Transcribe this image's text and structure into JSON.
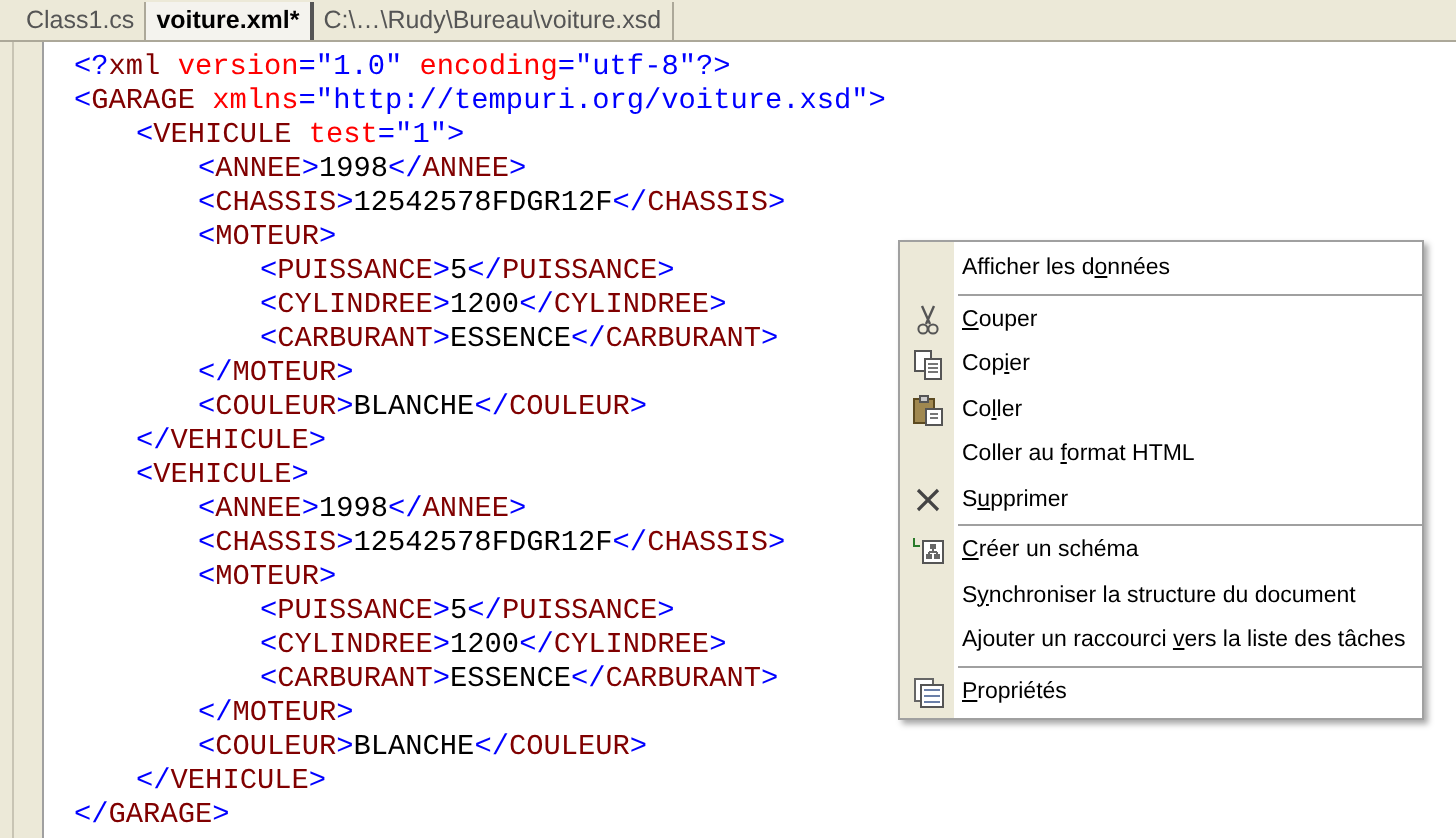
{
  "tabs": [
    {
      "label": "Class1.cs",
      "selected": false
    },
    {
      "label": "voiture.xml*",
      "selected": true
    },
    {
      "label": "C:\\…\\Rudy\\Bureau\\voiture.xsd",
      "selected": false
    }
  ],
  "code": [
    {
      "tokens": [
        {
          "kind": "punct",
          "text": "<?"
        },
        {
          "kind": "tag",
          "text": "xml"
        },
        {
          "kind": "attr",
          "text": " version"
        },
        {
          "kind": "punct",
          "text": "=\""
        },
        {
          "kind": "value",
          "text": "1.0"
        },
        {
          "kind": "punct",
          "text": "\""
        },
        {
          "kind": "attr",
          "text": " encoding"
        },
        {
          "kind": "punct",
          "text": "=\""
        },
        {
          "kind": "value",
          "text": "utf-8"
        },
        {
          "kind": "punct",
          "text": "\"?>"
        }
      ]
    },
    {
      "tokens": [
        {
          "kind": "punct",
          "text": "<"
        },
        {
          "kind": "tag",
          "text": "GARAGE"
        },
        {
          "kind": "attr",
          "text": " xmlns"
        },
        {
          "kind": "punct",
          "text": "=\""
        },
        {
          "kind": "value",
          "text": "http://tempuri.org/voiture.xsd"
        },
        {
          "kind": "punct",
          "text": "\">"
        }
      ],
      "close": [
        {
          "kind": "punct",
          "text": "</"
        },
        {
          "kind": "tag",
          "text": "GARAGE"
        },
        {
          "kind": "punct",
          "text": ">"
        }
      ],
      "children": [
        {
          "tokens": [
            {
              "kind": "punct",
              "text": "<"
            },
            {
              "kind": "tag",
              "text": "VEHICULE"
            },
            {
              "kind": "attr",
              "text": " test"
            },
            {
              "kind": "punct",
              "text": "=\""
            },
            {
              "kind": "value",
              "text": "1"
            },
            {
              "kind": "punct",
              "text": "\">"
            }
          ],
          "close": [
            {
              "kind": "punct",
              "text": "</"
            },
            {
              "kind": "tag",
              "text": "VEHICULE"
            },
            {
              "kind": "punct",
              "text": ">"
            }
          ],
          "children": [
            {
              "tokens": [
                {
                  "kind": "punct",
                  "text": "<"
                },
                {
                  "kind": "tag",
                  "text": "ANNEE"
                },
                {
                  "kind": "punct",
                  "text": ">"
                },
                {
                  "kind": "text",
                  "text": "1998"
                },
                {
                  "kind": "punct",
                  "text": "</"
                },
                {
                  "kind": "tag",
                  "text": "ANNEE"
                },
                {
                  "kind": "punct",
                  "text": ">"
                }
              ]
            },
            {
              "tokens": [
                {
                  "kind": "punct",
                  "text": "<"
                },
                {
                  "kind": "tag",
                  "text": "CHASSIS"
                },
                {
                  "kind": "punct",
                  "text": ">"
                },
                {
                  "kind": "text",
                  "text": "12542578FDGR12F"
                },
                {
                  "kind": "punct",
                  "text": "</"
                },
                {
                  "kind": "tag",
                  "text": "CHASSIS"
                },
                {
                  "kind": "punct",
                  "text": ">"
                }
              ]
            },
            {
              "tokens": [
                {
                  "kind": "punct",
                  "text": "<"
                },
                {
                  "kind": "tag",
                  "text": "MOTEUR"
                },
                {
                  "kind": "punct",
                  "text": ">"
                }
              ],
              "close": [
                {
                  "kind": "punct",
                  "text": "</"
                },
                {
                  "kind": "tag",
                  "text": "MOTEUR"
                },
                {
                  "kind": "punct",
                  "text": ">"
                }
              ],
              "children": [
                {
                  "tokens": [
                    {
                      "kind": "punct",
                      "text": "<"
                    },
                    {
                      "kind": "tag",
                      "text": "PUISSANCE"
                    },
                    {
                      "kind": "punct",
                      "text": ">"
                    },
                    {
                      "kind": "text",
                      "text": "5"
                    },
                    {
                      "kind": "punct",
                      "text": "</"
                    },
                    {
                      "kind": "tag",
                      "text": "PUISSANCE"
                    },
                    {
                      "kind": "punct",
                      "text": ">"
                    }
                  ]
                },
                {
                  "tokens": [
                    {
                      "kind": "punct",
                      "text": "<"
                    },
                    {
                      "kind": "tag",
                      "text": "CYLINDREE"
                    },
                    {
                      "kind": "punct",
                      "text": ">"
                    },
                    {
                      "kind": "text",
                      "text": "1200"
                    },
                    {
                      "kind": "punct",
                      "text": "</"
                    },
                    {
                      "kind": "tag",
                      "text": "CYLINDREE"
                    },
                    {
                      "kind": "punct",
                      "text": ">"
                    }
                  ]
                },
                {
                  "tokens": [
                    {
                      "kind": "punct",
                      "text": "<"
                    },
                    {
                      "kind": "tag",
                      "text": "CARBURANT"
                    },
                    {
                      "kind": "punct",
                      "text": ">"
                    },
                    {
                      "kind": "text",
                      "text": "ESSENCE"
                    },
                    {
                      "kind": "punct",
                      "text": "</"
                    },
                    {
                      "kind": "tag",
                      "text": "CARBURANT"
                    },
                    {
                      "kind": "punct",
                      "text": ">"
                    }
                  ]
                }
              ]
            },
            {
              "tokens": [
                {
                  "kind": "punct",
                  "text": "<"
                },
                {
                  "kind": "tag",
                  "text": "COULEUR"
                },
                {
                  "kind": "punct",
                  "text": ">"
                },
                {
                  "kind": "text",
                  "text": "BLANCHE"
                },
                {
                  "kind": "punct",
                  "text": "</"
                },
                {
                  "kind": "tag",
                  "text": "COULEUR"
                },
                {
                  "kind": "punct",
                  "text": ">"
                }
              ]
            }
          ]
        },
        {
          "tokens": [
            {
              "kind": "punct",
              "text": "<"
            },
            {
              "kind": "tag",
              "text": "VEHICULE"
            },
            {
              "kind": "punct",
              "text": ">"
            }
          ],
          "close": [
            {
              "kind": "punct",
              "text": "</"
            },
            {
              "kind": "tag",
              "text": "VEHICULE"
            },
            {
              "kind": "punct",
              "text": ">"
            }
          ],
          "children": [
            {
              "tokens": [
                {
                  "kind": "punct",
                  "text": "<"
                },
                {
                  "kind": "tag",
                  "text": "ANNEE"
                },
                {
                  "kind": "punct",
                  "text": ">"
                },
                {
                  "kind": "text",
                  "text": "1998"
                },
                {
                  "kind": "punct",
                  "text": "</"
                },
                {
                  "kind": "tag",
                  "text": "ANNEE"
                },
                {
                  "kind": "punct",
                  "text": ">"
                }
              ]
            },
            {
              "tokens": [
                {
                  "kind": "punct",
                  "text": "<"
                },
                {
                  "kind": "tag",
                  "text": "CHASSIS"
                },
                {
                  "kind": "punct",
                  "text": ">"
                },
                {
                  "kind": "text",
                  "text": "12542578FDGR12F"
                },
                {
                  "kind": "punct",
                  "text": "</"
                },
                {
                  "kind": "tag",
                  "text": "CHASSIS"
                },
                {
                  "kind": "punct",
                  "text": ">"
                }
              ]
            },
            {
              "tokens": [
                {
                  "kind": "punct",
                  "text": "<"
                },
                {
                  "kind": "tag",
                  "text": "MOTEUR"
                },
                {
                  "kind": "punct",
                  "text": ">"
                }
              ],
              "close": [
                {
                  "kind": "punct",
                  "text": "</"
                },
                {
                  "kind": "tag",
                  "text": "MOTEUR"
                },
                {
                  "kind": "punct",
                  "text": ">"
                }
              ],
              "children": [
                {
                  "tokens": [
                    {
                      "kind": "punct",
                      "text": "<"
                    },
                    {
                      "kind": "tag",
                      "text": "PUISSANCE"
                    },
                    {
                      "kind": "punct",
                      "text": ">"
                    },
                    {
                      "kind": "text",
                      "text": "5"
                    },
                    {
                      "kind": "punct",
                      "text": "</"
                    },
                    {
                      "kind": "tag",
                      "text": "PUISSANCE"
                    },
                    {
                      "kind": "punct",
                      "text": ">"
                    }
                  ]
                },
                {
                  "tokens": [
                    {
                      "kind": "punct",
                      "text": "<"
                    },
                    {
                      "kind": "tag",
                      "text": "CYLINDREE"
                    },
                    {
                      "kind": "punct",
                      "text": ">"
                    },
                    {
                      "kind": "text",
                      "text": "1200"
                    },
                    {
                      "kind": "punct",
                      "text": "</"
                    },
                    {
                      "kind": "tag",
                      "text": "CYLINDREE"
                    },
                    {
                      "kind": "punct",
                      "text": ">"
                    }
                  ]
                },
                {
                  "tokens": [
                    {
                      "kind": "punct",
                      "text": "<"
                    },
                    {
                      "kind": "tag",
                      "text": "CARBURANT"
                    },
                    {
                      "kind": "punct",
                      "text": ">"
                    },
                    {
                      "kind": "text",
                      "text": "ESSENCE"
                    },
                    {
                      "kind": "punct",
                      "text": "</"
                    },
                    {
                      "kind": "tag",
                      "text": "CARBURANT"
                    },
                    {
                      "kind": "punct",
                      "text": ">"
                    }
                  ]
                }
              ]
            },
            {
              "tokens": [
                {
                  "kind": "punct",
                  "text": "<"
                },
                {
                  "kind": "tag",
                  "text": "COULEUR"
                },
                {
                  "kind": "punct",
                  "text": ">"
                },
                {
                  "kind": "text",
                  "text": "BLANCHE"
                },
                {
                  "kind": "punct",
                  "text": "</"
                },
                {
                  "kind": "tag",
                  "text": "COULEUR"
                },
                {
                  "kind": "punct",
                  "text": ">"
                }
              ]
            }
          ]
        }
      ]
    }
  ],
  "context_menu": [
    {
      "kind": "plain",
      "before": "Afficher les d",
      "key": "o",
      "after": "nnées"
    },
    {
      "kind": "separator"
    },
    {
      "kind": "cut",
      "key": "C",
      "after": "ouper"
    },
    {
      "kind": "copy",
      "before": "Cop",
      "key": "i",
      "after": "er"
    },
    {
      "kind": "paste",
      "before": "Co",
      "key": "l",
      "after": "ler"
    },
    {
      "kind": "plain",
      "before": "Coller au ",
      "key": "f",
      "after": "ormat HTML"
    },
    {
      "kind": "delete",
      "before": "S",
      "key": "u",
      "after": "pprimer"
    },
    {
      "kind": "separator"
    },
    {
      "kind": "schema",
      "key": "C",
      "after": "réer un schéma"
    },
    {
      "kind": "plain",
      "before": "S",
      "key": "y",
      "after": "nchroniser la structure du document"
    },
    {
      "kind": "plain",
      "before": "Ajouter un raccourci ",
      "key": "v",
      "after": "ers la liste des tâches"
    },
    {
      "kind": "separator"
    },
    {
      "kind": "properties",
      "key": "P",
      "after": "ropriétés"
    }
  ]
}
